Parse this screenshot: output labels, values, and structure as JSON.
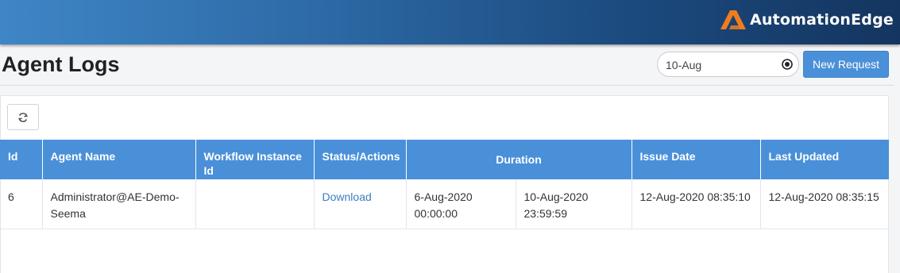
{
  "brand": {
    "name": "AutomationEdge"
  },
  "header": {
    "title": "Agent Logs"
  },
  "search": {
    "value": "10-Aug"
  },
  "actions": {
    "new_request_label": "New Request"
  },
  "table": {
    "columns": {
      "id": "Id",
      "agent_name": "Agent Name",
      "workflow_instance_id": "Workflow Instance Id",
      "status_actions": "Status/Actions",
      "duration": "Duration",
      "issue_date": "Issue Date",
      "last_updated": "Last Updated"
    },
    "rows": [
      {
        "id": "6",
        "agent_name": "Administrator@AE-Demo-Seema",
        "workflow_instance_id": "",
        "status_action": "Download",
        "duration_from": "6-Aug-2020 00:00:00",
        "duration_to": "10-Aug-2020 23:59:59",
        "issue_date": "12-Aug-2020 08:35:10",
        "last_updated": "12-Aug-2020 08:35:15"
      }
    ]
  },
  "icons": {
    "refresh": "refresh-icon",
    "clear": "clear-icon",
    "logo": "automationedge-logo-icon"
  },
  "colors": {
    "accent": "#4a90d9",
    "link": "#3a7fc1",
    "logo_orange": "#f07c1e"
  }
}
